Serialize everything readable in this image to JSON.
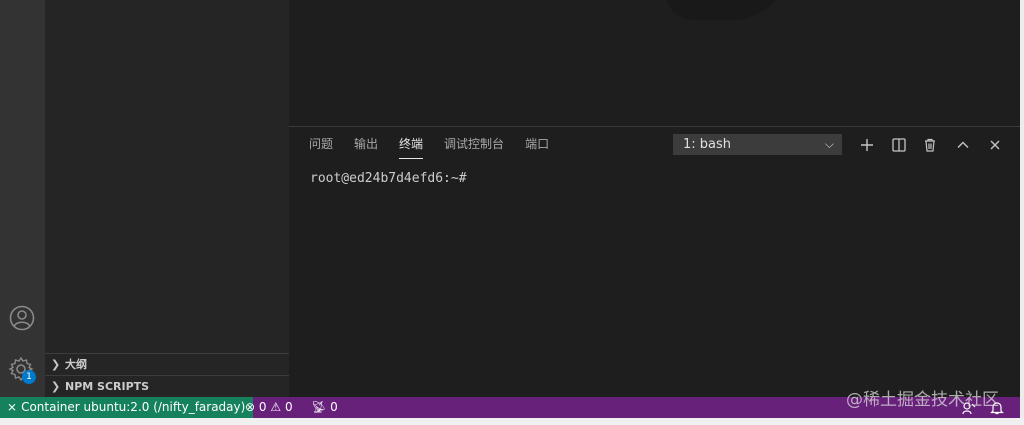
{
  "panel": {
    "tabs": [
      {
        "label": "问题",
        "active": false
      },
      {
        "label": "输出",
        "active": false
      },
      {
        "label": "终端",
        "active": true
      },
      {
        "label": "调试控制台",
        "active": false
      },
      {
        "label": "端口",
        "active": false
      }
    ],
    "terminal_select": "1: bash",
    "actions": [
      "plus-icon",
      "split-icon",
      "trash-icon",
      "chevron-up-icon",
      "close-icon"
    ]
  },
  "terminal": {
    "prompt": "root@ed24b7d4efd6:~#"
  },
  "activity": {
    "settings_badge": "1"
  },
  "sidebar": {
    "sections": [
      {
        "label": "大纲"
      },
      {
        "label": "NPM SCRIPTS"
      }
    ]
  },
  "statusbar": {
    "remote": "Container ubuntu:2.0 (/nifty_faraday)",
    "errors": "0",
    "warnings": "0",
    "ports": "0"
  },
  "watermark": "@稀土掘金技术社区",
  "colors": {
    "statusbar_bg": "#68217a",
    "remote_bg": "#16825d",
    "badge": "#007acc"
  }
}
